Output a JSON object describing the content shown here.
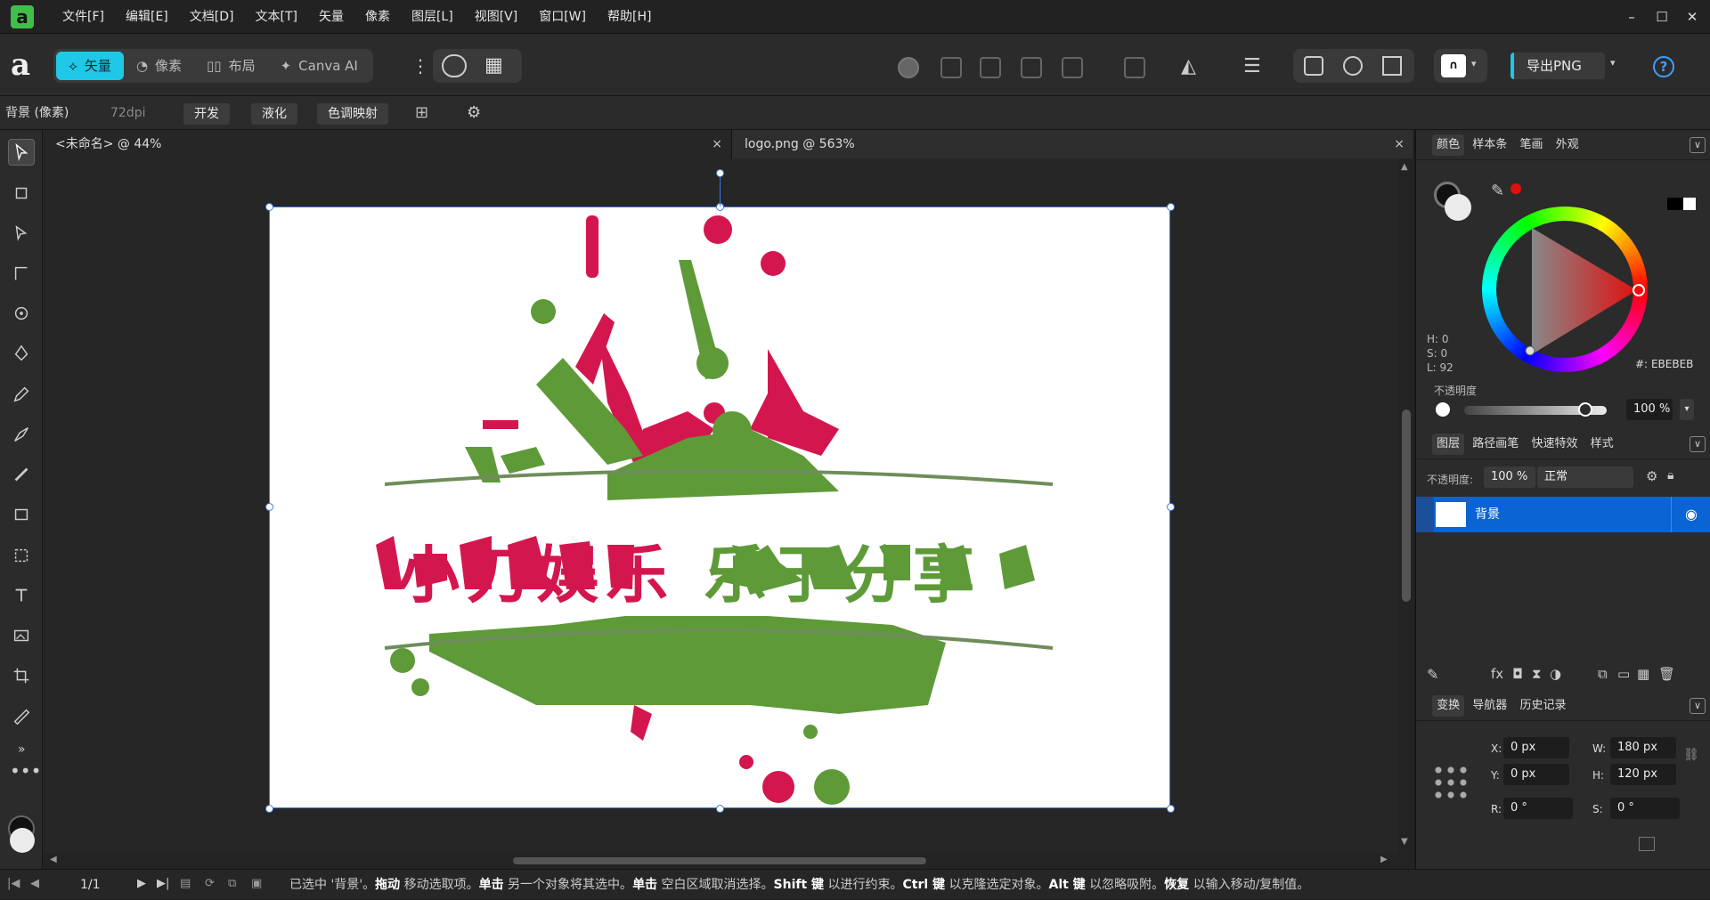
{
  "menu": [
    "文件[F]",
    "编辑[E]",
    "文档[D]",
    "文本[T]",
    "矢量",
    "像素",
    "图层[L]",
    "视图[V]",
    "窗口[W]",
    "帮助[H]"
  ],
  "personas": [
    {
      "label": "矢量",
      "active": true
    },
    {
      "label": "像素",
      "active": false
    },
    {
      "label": "布局",
      "active": false
    },
    {
      "label": "Canva AI",
      "active": false
    }
  ],
  "export_label": "导出PNG",
  "context": {
    "layer_label": "背景 (像素)",
    "dpi": "72dpi",
    "buttons": [
      "开发",
      "液化",
      "色调映射"
    ]
  },
  "doc_tabs": [
    {
      "label": "<未命名> @ 44%",
      "close": "×"
    },
    {
      "label": "logo.png @ 563%",
      "close": "×"
    }
  ],
  "logo": {
    "text": "小刀娱乐 乐于分享",
    "accent": "#d4164f",
    "green": "#5e9a38"
  },
  "color_panel": {
    "tabs": [
      "颜色",
      "样本条",
      "笔画",
      "外观"
    ],
    "h": "H: 0",
    "s": "S: 0",
    "l": "L: 92",
    "hex_label": "#:",
    "hex": "EBEBEB",
    "opacity_label": "不透明度",
    "opacity": "100 %"
  },
  "layers_panel": {
    "tabs": [
      "图层",
      "路径画笔",
      "快速特效",
      "样式"
    ],
    "opacity_label": "不透明度:",
    "opacity": "100 %",
    "blend": "正常",
    "layer_name": "背景"
  },
  "transform_panel": {
    "tabs": [
      "变换",
      "导航器",
      "历史记录"
    ],
    "x_label": "X:",
    "x": "0 px",
    "y_label": "Y:",
    "y": "0 px",
    "w_label": "W:",
    "w": "180 px",
    "h_label": "H:",
    "h": "120 px",
    "r_label": "R:",
    "r": "0 °",
    "s_label": "S:",
    "s": "0 °"
  },
  "status": {
    "page": "1/1",
    "hint_parts": [
      {
        "t": "已选中 '背景'。",
        "b": false
      },
      {
        "t": "拖动",
        "b": true
      },
      {
        "t": " 移动选取项。",
        "b": false
      },
      {
        "t": "单击",
        "b": true
      },
      {
        "t": " 另一个对象将其选中。",
        "b": false
      },
      {
        "t": "单击",
        "b": true
      },
      {
        "t": " 空白区域取消选择。",
        "b": false
      },
      {
        "t": "Shift 键",
        "b": true
      },
      {
        "t": " 以进行约束。",
        "b": false
      },
      {
        "t": "Ctrl 键",
        "b": true
      },
      {
        "t": " 以克隆选定对象。",
        "b": false
      },
      {
        "t": "Alt 键",
        "b": true
      },
      {
        "t": " 以忽略吸附。",
        "b": false
      },
      {
        "t": "恢复",
        "b": true
      },
      {
        "t": " 以输入移动/复制值。",
        "b": false
      }
    ]
  }
}
